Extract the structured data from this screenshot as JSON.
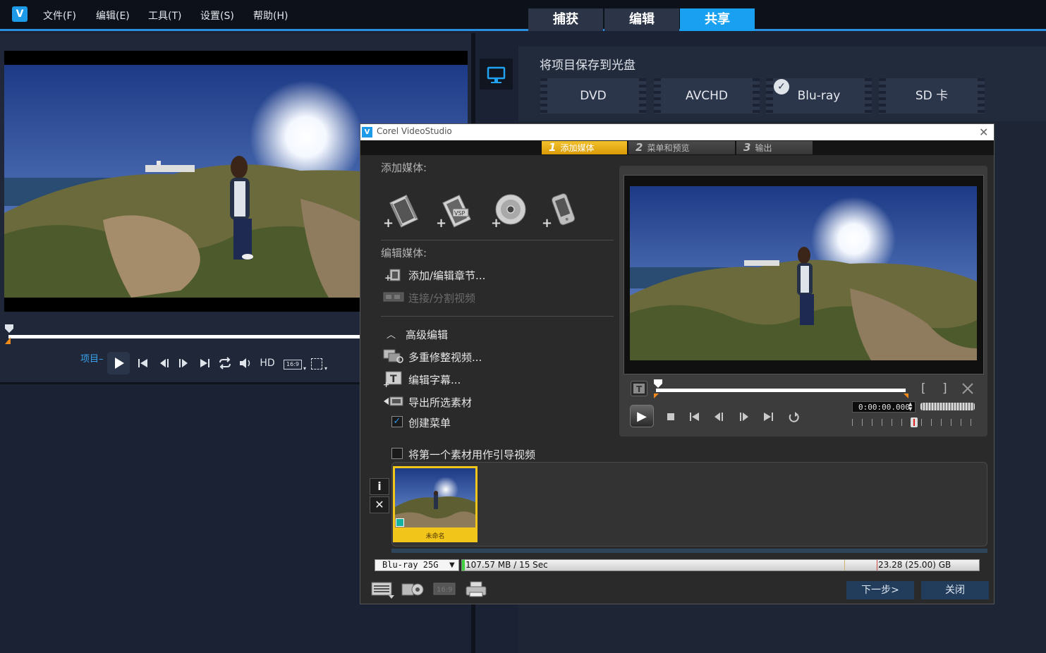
{
  "app": {
    "logo": "V"
  },
  "menu": [
    "文件(F)",
    "编辑(E)",
    "工具(T)",
    "设置(S)",
    "帮助(H)"
  ],
  "tabs": [
    {
      "label": "捕获"
    },
    {
      "label": "编辑"
    },
    {
      "label": "共享",
      "active": true
    }
  ],
  "left_player": {
    "project_label": "项目–",
    "controls": [
      "play",
      "skip-start",
      "step-back",
      "step-forward",
      "skip-end",
      "repeat",
      "volume",
      "HD",
      "16:9",
      "crop"
    ],
    "hd_label": "HD",
    "aspect_label": "16:9"
  },
  "share": {
    "heading": "将项目保存到光盘",
    "disc_options": [
      "DVD",
      "AVCHD",
      "Blu-ray",
      "SD 卡"
    ],
    "selected": "Blu-ray"
  },
  "dialog": {
    "title": "Corel VideoStudio",
    "close": "✕",
    "steps": [
      {
        "num": "1",
        "label": "添加媒体",
        "active": true
      },
      {
        "num": "2",
        "label": "菜单和预览"
      },
      {
        "num": "3",
        "label": "输出"
      }
    ],
    "add_media_title": "添加媒体:",
    "add_media_icons": [
      "video-file-icon",
      "vsp-project-icon",
      "disc-icon",
      "mobile-device-icon"
    ],
    "edit_media_title": "编辑媒体:",
    "add_chapter": "添加/编辑章节...",
    "join_split": "连接/分割视频",
    "advanced_edit": "高级编辑",
    "multi_trim": "多重修整视频...",
    "edit_subtitle": "编辑字幕...",
    "export_selected": "导出所选素材",
    "create_menu": "创建菜单",
    "create_menu_checked": true,
    "first_clip_intro": "将第一个素材用作引导视频",
    "first_clip_intro_checked": false,
    "preview": {
      "timecode": "0:00:00.000",
      "mark_in": "[",
      "mark_out": "]"
    },
    "clip": {
      "label": "未命名"
    },
    "info_btn": "i",
    "delete_btn": "✕",
    "disc_type": "Blu-ray 25G",
    "used_size": "107.57 MB / 15 Sec",
    "capacity": "23.28 (25.00) GB",
    "next_btn": "下一步>",
    "close_btn": "关闭"
  },
  "colors": {
    "accent": "#1aa0f0",
    "step_active": "#f0b81c",
    "clip_frame": "#f2c51b"
  }
}
